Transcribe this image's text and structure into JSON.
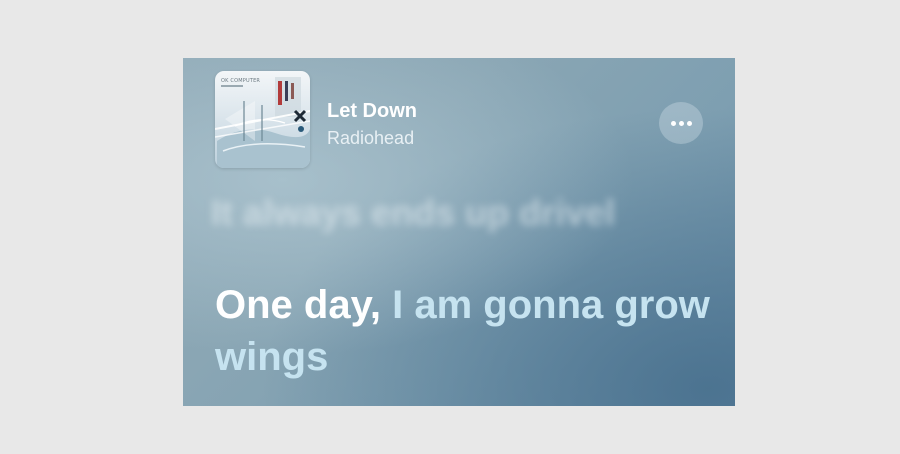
{
  "track": {
    "title": "Let Down",
    "artist": "Radiohead",
    "album_art_text": "OK COMPUTER",
    "album_art_icon": "album-art"
  },
  "controls": {
    "more_icon": "ellipsis-icon"
  },
  "lyrics": {
    "previous_line": "It always ends up drivel",
    "current_line_sung": "One day,",
    "current_line_unsung": "I am gonna grow wings"
  },
  "colors": {
    "sung": "#ffffff",
    "unsung": "#c6e3f0"
  }
}
